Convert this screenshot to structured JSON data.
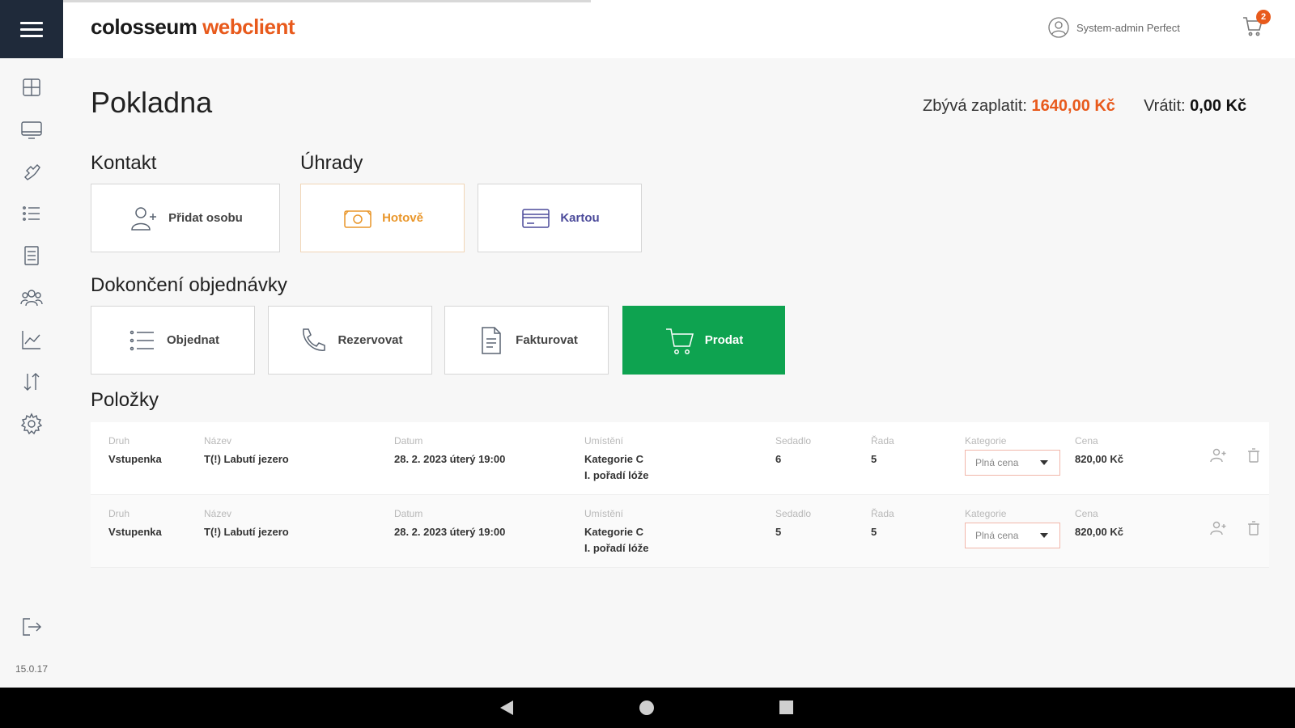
{
  "app": {
    "logo_part1": "colosseum",
    "logo_part2": "webclient",
    "user_name": "System-admin Perfect",
    "cart_count": "2",
    "version": "15.0.17"
  },
  "sidebar": {
    "items": [
      {
        "icon": "dashboard-icon"
      },
      {
        "icon": "monitor-icon"
      },
      {
        "icon": "phone-icon"
      },
      {
        "icon": "list-icon"
      },
      {
        "icon": "document-icon"
      },
      {
        "icon": "people-icon"
      },
      {
        "icon": "chart-icon"
      },
      {
        "icon": "sort-icon"
      },
      {
        "icon": "gear-icon"
      }
    ],
    "logout_icon": "logout-icon"
  },
  "page": {
    "title": "Pokladna",
    "remaining_label": "Zbývá zaplatit:",
    "remaining_value": "1640,00 Kč",
    "return_label": "Vrátit:",
    "return_value": "0,00 Kč"
  },
  "sections": {
    "contact": "Kontakt",
    "payments": "Úhrady",
    "finish": "Dokončení objednávky",
    "items": "Položky"
  },
  "buttons": {
    "add_person": "Přidat osobu",
    "cash": "Hotově",
    "card": "Kartou",
    "order": "Objednat",
    "reserve": "Rezervovat",
    "invoice": "Fakturovat",
    "sell": "Prodat"
  },
  "columns": {
    "type": "Druh",
    "name": "Název",
    "date": "Datum",
    "location": "Umístění",
    "seat": "Sedadlo",
    "row": "Řada",
    "category": "Kategorie",
    "price": "Cena"
  },
  "items": [
    {
      "type": "Vstupenka",
      "name": "T(!) Labutí jezero",
      "date": "28. 2. 2023 úterý 19:00",
      "location_line1": "Kategorie C",
      "location_line2": "I. pořadí lóže",
      "seat": "6",
      "row": "5",
      "category": "Plná cena",
      "price": "820,00 Kč"
    },
    {
      "type": "Vstupenka",
      "name": "T(!) Labutí jezero",
      "date": "28. 2. 2023 úterý 19:00",
      "location_line1": "Kategorie C",
      "location_line2": "I. pořadí lóže",
      "seat": "5",
      "row": "5",
      "category": "Plná cena",
      "price": "820,00 Kč"
    }
  ],
  "colors": {
    "accent": "#e85a1c",
    "sell": "#0ea350",
    "sidebar_dark": "#1f2a3a"
  }
}
